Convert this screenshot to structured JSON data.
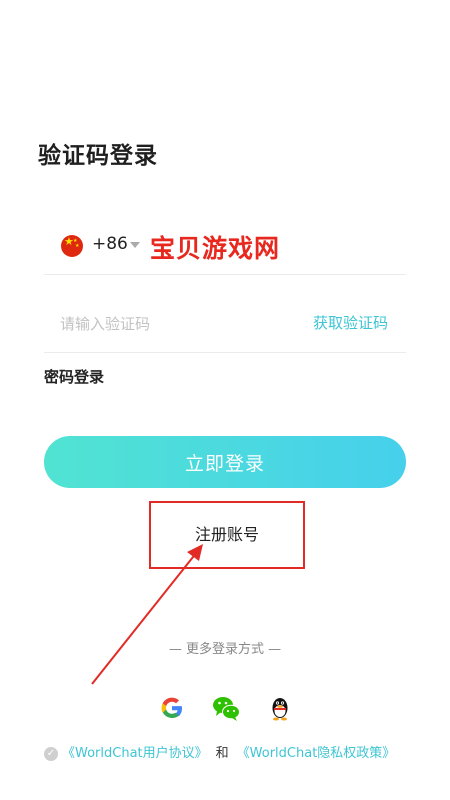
{
  "header": {
    "title": "验证码登录"
  },
  "phone": {
    "country_code": "+86",
    "flag_icon": "china-flag-icon",
    "watermark": "宝贝游戏网"
  },
  "verification": {
    "placeholder": "请输入验证码",
    "get_code_label": "获取验证码"
  },
  "password_login_label": "密码登录",
  "login_button_label": "立即登录",
  "register_label": "注册账号",
  "more_login_label": "— 更多登录方式 —",
  "social": [
    {
      "name": "google-icon"
    },
    {
      "name": "wechat-icon"
    },
    {
      "name": "qq-icon"
    }
  ],
  "agreement": {
    "user_agreement": "《WorldChat用户协议》",
    "and": "和",
    "privacy_policy": "《WorldChat隐私权政策》"
  },
  "colors": {
    "accent": "#3ec5d4",
    "button_gradient_start": "#51e3d2",
    "button_gradient_end": "#46d0ec",
    "annotation_red": "#e32b25"
  }
}
